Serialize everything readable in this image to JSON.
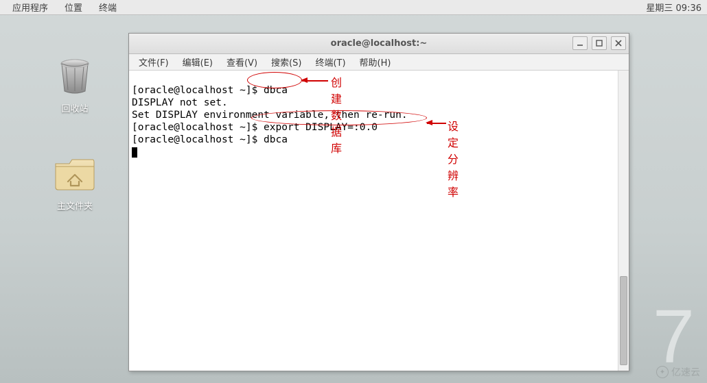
{
  "top_panel": {
    "menus": [
      "应用程序",
      "位置",
      "终端"
    ],
    "clock": "星期三 09:36"
  },
  "desktop": {
    "trash_label": "回收站",
    "home_label": "主文件夹"
  },
  "window": {
    "title": "oracle@localhost:~",
    "menubar": [
      "文件(F)",
      "编辑(E)",
      "查看(V)",
      "搜索(S)",
      "终端(T)",
      "帮助(H)"
    ]
  },
  "terminal": {
    "lines": [
      "[oracle@localhost ~]$ dbca",
      "DISPLAY not set.",
      "Set DISPLAY environment variable, then re-run.",
      "[oracle@localhost ~]$ export DISPLAY=:0.0",
      "[oracle@localhost ~]$ dbca"
    ]
  },
  "annotations": {
    "anno1": "创建数据库",
    "anno2": "设定分辨率"
  },
  "big_number": "7",
  "watermark": "亿速云"
}
